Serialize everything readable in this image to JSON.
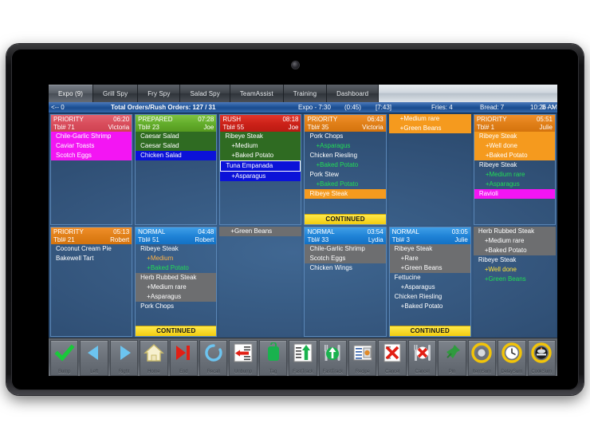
{
  "tabs": [
    {
      "label": "Expo (9)",
      "active": true
    },
    {
      "label": "Grill Spy",
      "active": false
    },
    {
      "label": "Fry Spy",
      "active": false
    },
    {
      "label": "Salad Spy",
      "active": false
    },
    {
      "label": "TeamAssist",
      "active": false
    },
    {
      "label": "Training",
      "active": false
    },
    {
      "label": "Dashboard",
      "active": false
    }
  ],
  "statusbar": {
    "left_arrow": "<-- 0",
    "total_orders": "Total Orders/Rush Orders: 127 / 31",
    "expo": "Expo  - 7:30",
    "timer_a": "(0:45)",
    "timer_b": "[7:43]",
    "fries": "Fries: 4",
    "bread": "Bread: 7",
    "clock": "10:26 AM",
    "right_arrow": "0 -->"
  },
  "colors": {
    "priority_orange": "#f08f2a",
    "priority_red": "#e2616e",
    "prepared_green": "#7dc242",
    "rush_red": "#e2352b",
    "normal_blue": "#3f9fe8",
    "continued_yellow": "#ffe94a",
    "magenta": "#f315f3",
    "select_gray": "#6d6e70",
    "mod_green": "#22dd55",
    "screen_blue": "#2c4d74"
  },
  "tickets": [
    {
      "id": "t1",
      "has_header": true,
      "header_style": "hd-priority-red",
      "status": "PRIORITY",
      "time": "06:20",
      "table": "Tbl# 71",
      "server": "Victoria",
      "lines": [
        {
          "text": "Chile-Garlic Shrimp",
          "bg": "bg-magenta",
          "color": "c-white",
          "mod": false
        },
        {
          "text": "Caviar Toasts",
          "bg": "bg-magenta",
          "color": "c-white",
          "mod": false
        },
        {
          "text": "Scotch Eggs",
          "bg": "bg-magenta",
          "color": "c-white",
          "mod": false
        }
      ],
      "continued": false
    },
    {
      "id": "t2",
      "has_header": true,
      "header_style": "hd-prepared",
      "status": "PREPARED",
      "time": "07:28",
      "table": "Tbl# 23",
      "server": "Joe",
      "lines": [
        {
          "text": "Caesar Salad",
          "bg": "bg-green",
          "color": "c-white",
          "mod": false
        },
        {
          "text": "Caesar Salad",
          "bg": "bg-green",
          "color": "c-white",
          "mod": false
        },
        {
          "text": "Chicken Salad",
          "bg": "bg-blue",
          "color": "c-white",
          "mod": false
        }
      ],
      "continued": false
    },
    {
      "id": "t3",
      "has_header": true,
      "header_style": "hd-rush",
      "status": "RUSH",
      "time": "08:18",
      "table": "Tbl# 55",
      "server": "Joe",
      "lines": [
        {
          "text": "Ribeye Steak",
          "bg": "bg-green",
          "color": "c-white",
          "mod": false
        },
        {
          "text": "+Medium",
          "bg": "bg-green",
          "color": "c-white",
          "mod": true
        },
        {
          "text": "+Baked Potato",
          "bg": "bg-green",
          "color": "c-white",
          "mod": true
        },
        {
          "text": "Tuna Empanada",
          "bg": "bg-blue-b",
          "color": "c-white",
          "mod": false
        },
        {
          "text": "+Asparagus",
          "bg": "bg-blue",
          "color": "c-white",
          "mod": true
        }
      ],
      "continued": false
    },
    {
      "id": "t4",
      "has_header": true,
      "header_style": "hd-priority",
      "status": "PRIORITY",
      "time": "06:43",
      "table": "Tbl# 35",
      "server": "Victoria",
      "lines": [
        {
          "text": "Pork Chops",
          "bg": "bg-none",
          "color": "c-white",
          "mod": false
        },
        {
          "text": "+Asparagus",
          "bg": "bg-none",
          "color": "c-green",
          "mod": true
        },
        {
          "text": "Chicken Riesling",
          "bg": "bg-none",
          "color": "c-white",
          "mod": false
        },
        {
          "text": "+Baked Potato",
          "bg": "bg-none",
          "color": "c-green",
          "mod": true
        },
        {
          "text": "Pork Stew",
          "bg": "bg-none",
          "color": "c-white",
          "mod": false
        },
        {
          "text": "+Baked Potato",
          "bg": "bg-none",
          "color": "c-green",
          "mod": true
        },
        {
          "text": "Ribeye Steak",
          "bg": "bg-orange",
          "color": "c-white",
          "mod": false
        }
      ],
      "continued": true,
      "continued_label": "CONTINUED"
    },
    {
      "id": "t5",
      "has_header": false,
      "header_style": "",
      "status": "",
      "time": "",
      "table": "",
      "server": "",
      "lines": [
        {
          "text": "+Medium rare",
          "bg": "bg-orange",
          "color": "c-white",
          "mod": true
        },
        {
          "text": "+Green Beans",
          "bg": "bg-orange",
          "color": "c-white",
          "mod": true
        }
      ],
      "continued": false
    },
    {
      "id": "t6",
      "has_header": true,
      "header_style": "hd-priority",
      "status": "PRIORITY",
      "time": "05:51",
      "table": "Tbl# 1",
      "server": "Julie",
      "lines": [
        {
          "text": "Ribeye Steak",
          "bg": "bg-orange",
          "color": "c-white",
          "mod": false
        },
        {
          "text": "+Well done",
          "bg": "bg-orange",
          "color": "c-white",
          "mod": true
        },
        {
          "text": "+Baked Potato",
          "bg": "bg-orange",
          "color": "c-white",
          "mod": true
        },
        {
          "text": "Ribeye Steak",
          "bg": "bg-none",
          "color": "c-white",
          "mod": false
        },
        {
          "text": "+Medium rare",
          "bg": "bg-none",
          "color": "c-green",
          "mod": true
        },
        {
          "text": "+Asparagus",
          "bg": "bg-none",
          "color": "c-green",
          "mod": true
        },
        {
          "text": "Ravioli",
          "bg": "bg-magenta",
          "color": "c-white",
          "mod": false
        }
      ],
      "continued": false
    },
    {
      "id": "t7",
      "has_header": true,
      "header_style": "hd-priority",
      "status": "PRIORITY",
      "time": "05:13",
      "table": "Tbl# 21",
      "server": "Robert",
      "lines": [
        {
          "text": "Coconut Cream Pie",
          "bg": "bg-none",
          "color": "c-white",
          "mod": false
        },
        {
          "text": "Bakewell Tart",
          "bg": "bg-none",
          "color": "c-white",
          "mod": false
        }
      ],
      "continued": false
    },
    {
      "id": "t8",
      "has_header": true,
      "header_style": "hd-normal",
      "status": "NORMAL",
      "time": "04:48",
      "table": "Tbl# 51",
      "server": "Robert",
      "lines": [
        {
          "text": "Ribeye Steak",
          "bg": "bg-none",
          "color": "c-white",
          "mod": false
        },
        {
          "text": "+Medium",
          "bg": "bg-none",
          "color": "c-orange",
          "mod": true
        },
        {
          "text": "+Baked Potato",
          "bg": "bg-none",
          "color": "c-green",
          "mod": true
        },
        {
          "text": "Herb Rubbed Steak",
          "bg": "bg-gray",
          "color": "c-white",
          "mod": false
        },
        {
          "text": "+Medium rare",
          "bg": "bg-gray",
          "color": "c-white",
          "mod": true
        },
        {
          "text": "+Asparagus",
          "bg": "bg-gray",
          "color": "c-white",
          "mod": true
        },
        {
          "text": "Pork Chops",
          "bg": "bg-none",
          "color": "c-white",
          "mod": false
        }
      ],
      "continued": true,
      "continued_label": "CONTINUED"
    },
    {
      "id": "t9",
      "has_header": false,
      "header_style": "",
      "status": "",
      "time": "",
      "table": "",
      "server": "",
      "lines": [
        {
          "text": "+Green Beans",
          "bg": "bg-gray",
          "color": "c-white",
          "mod": true
        }
      ],
      "continued": false
    },
    {
      "id": "t10",
      "has_header": true,
      "header_style": "hd-normal",
      "status": "NORMAL",
      "time": "03:54",
      "table": "Tbl# 33",
      "server": "Lydia",
      "lines": [
        {
          "text": "Chile-Garlic Shrimp",
          "bg": "bg-gray",
          "color": "c-white",
          "mod": false
        },
        {
          "text": "Scotch Eggs",
          "bg": "bg-gray",
          "color": "c-white",
          "mod": false
        },
        {
          "text": "Chicken Wings",
          "bg": "bg-none",
          "color": "c-white",
          "mod": false
        }
      ],
      "continued": false
    },
    {
      "id": "t11",
      "has_header": true,
      "header_style": "hd-normal",
      "status": "NORMAL",
      "time": "03:05",
      "table": "Tbl# 3",
      "server": "Julie",
      "lines": [
        {
          "text": "Ribeye Steak",
          "bg": "bg-gray",
          "color": "c-white",
          "mod": false
        },
        {
          "text": "+Rare",
          "bg": "bg-gray",
          "color": "c-white",
          "mod": true
        },
        {
          "text": "+Green Beans",
          "bg": "bg-gray",
          "color": "c-white",
          "mod": true
        },
        {
          "text": "Fettucine",
          "bg": "bg-none",
          "color": "c-white",
          "mod": false
        },
        {
          "text": "+Asparagus",
          "bg": "bg-none",
          "color": "c-white",
          "mod": true
        },
        {
          "text": "Chicken Riesling",
          "bg": "bg-none",
          "color": "c-white",
          "mod": false
        },
        {
          "text": "+Baked Potato",
          "bg": "bg-none",
          "color": "c-white",
          "mod": true
        }
      ],
      "continued": true,
      "continued_label": "CONTINUED"
    },
    {
      "id": "t12",
      "has_header": false,
      "header_style": "",
      "status": "",
      "time": "",
      "table": "",
      "server": "",
      "lines": [
        {
          "text": "Herb Rubbed Steak",
          "bg": "bg-gray",
          "color": "c-white",
          "mod": false
        },
        {
          "text": "+Medium rare",
          "bg": "bg-gray",
          "color": "c-white",
          "mod": true
        },
        {
          "text": "+Baked Potato",
          "bg": "bg-gray",
          "color": "c-white",
          "mod": true
        },
        {
          "text": "Ribeye Steak",
          "bg": "bg-none",
          "color": "c-white",
          "mod": false
        },
        {
          "text": "+Well done",
          "bg": "bg-none",
          "color": "c-yellow",
          "mod": true
        },
        {
          "text": "+Green Beans",
          "bg": "bg-none",
          "color": "c-green",
          "mod": true
        }
      ],
      "continued": false
    }
  ],
  "toolbar": [
    {
      "label": "Bump",
      "icon": "checkmark-icon"
    },
    {
      "label": "Left",
      "icon": "triangle-left-icon"
    },
    {
      "label": "Right",
      "icon": "triangle-right-icon"
    },
    {
      "label": "Home",
      "icon": "home-icon"
    },
    {
      "label": "End",
      "icon": "end-icon"
    },
    {
      "label": "Recall",
      "icon": "refresh-circle-icon"
    },
    {
      "label": "Unbump",
      "icon": "list-arrow-left-icon"
    },
    {
      "label": "Tag",
      "icon": "tag-icon"
    },
    {
      "label": "FastTrack",
      "icon": "list-arrow-up-icon"
    },
    {
      "label": "FastTrack",
      "icon": "fork-knife-arrow-up-icon"
    },
    {
      "label": "Recipe",
      "icon": "recipe-card-icon"
    },
    {
      "label": "Cancel",
      "icon": "cancel-order-icon"
    },
    {
      "label": "Cancel",
      "icon": "cancel-item-icon"
    },
    {
      "label": "Pin",
      "icon": "pushpin-icon"
    },
    {
      "label": "ItemSum",
      "icon": "plate-circle-icon"
    },
    {
      "label": "DelaySum",
      "icon": "clock-circle-icon"
    },
    {
      "label": "CookSum",
      "icon": "cook-circle-icon"
    }
  ]
}
